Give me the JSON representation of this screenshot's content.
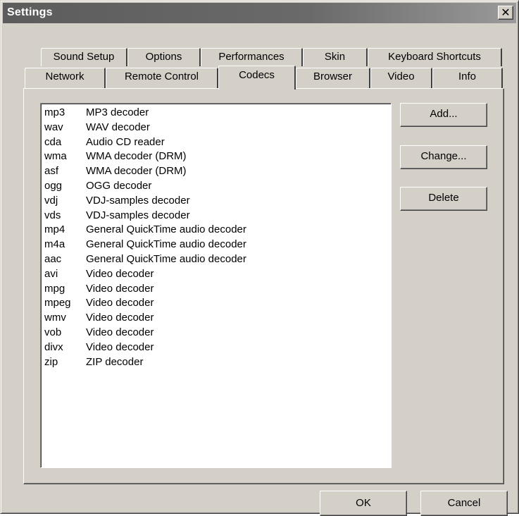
{
  "window": {
    "title": "Settings",
    "close_symbol": "✕"
  },
  "tabs_row1": [
    {
      "label": "Sound Setup"
    },
    {
      "label": "Options"
    },
    {
      "label": "Performances"
    },
    {
      "label": "Skin"
    },
    {
      "label": "Keyboard Shortcuts"
    }
  ],
  "tabs_row2": [
    {
      "label": "Network"
    },
    {
      "label": "Remote Control"
    },
    {
      "label": "Codecs",
      "active": true
    },
    {
      "label": "Browser"
    },
    {
      "label": "Video"
    },
    {
      "label": "Info"
    }
  ],
  "codecs": [
    {
      "ext": "mp3",
      "desc": "MP3 decoder"
    },
    {
      "ext": "wav",
      "desc": "WAV decoder"
    },
    {
      "ext": "cda",
      "desc": "Audio CD reader"
    },
    {
      "ext": "wma",
      "desc": "WMA decoder (DRM)"
    },
    {
      "ext": "asf",
      "desc": "WMA decoder (DRM)"
    },
    {
      "ext": "ogg",
      "desc": "OGG decoder"
    },
    {
      "ext": "vdj",
      "desc": "VDJ-samples decoder"
    },
    {
      "ext": "vds",
      "desc": "VDJ-samples decoder"
    },
    {
      "ext": "mp4",
      "desc": "General QuickTime audio decoder"
    },
    {
      "ext": "m4a",
      "desc": "General QuickTime audio decoder"
    },
    {
      "ext": "aac",
      "desc": "General QuickTime audio decoder"
    },
    {
      "ext": "avi",
      "desc": "Video decoder"
    },
    {
      "ext": "mpg",
      "desc": "Video decoder"
    },
    {
      "ext": "mpeg",
      "desc": "Video decoder"
    },
    {
      "ext": "wmv",
      "desc": "Video decoder"
    },
    {
      "ext": "vob",
      "desc": "Video decoder"
    },
    {
      "ext": "divx",
      "desc": "Video decoder"
    },
    {
      "ext": "zip",
      "desc": "ZIP decoder"
    }
  ],
  "side_buttons": {
    "add": "Add...",
    "change": "Change...",
    "delete": "Delete"
  },
  "footer_buttons": {
    "ok": "OK",
    "cancel": "Cancel"
  },
  "colors": {
    "face": "#d4d0c8",
    "title_bar": "#5c5c5c",
    "list_bg": "#ffffff"
  }
}
